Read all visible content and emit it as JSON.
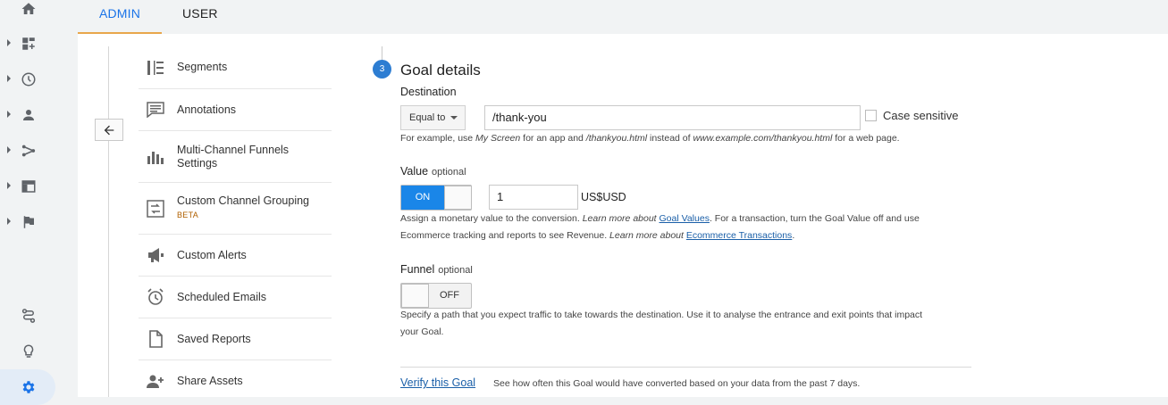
{
  "rail": {
    "items": [
      {
        "icon": "home-icon"
      },
      {
        "icon": "dashboard-add-icon"
      },
      {
        "icon": "clock-icon"
      },
      {
        "icon": "person-icon"
      },
      {
        "icon": "acquisition-icon"
      },
      {
        "icon": "behavior-icon"
      },
      {
        "icon": "flag-icon"
      },
      {
        "icon": "route-icon"
      },
      {
        "icon": "lightbulb-icon"
      },
      {
        "icon": "gear-icon"
      }
    ]
  },
  "tabs": {
    "admin": "ADMIN",
    "user": "USER"
  },
  "menu": {
    "items": [
      {
        "label": "Segments",
        "icon": "segments-icon"
      },
      {
        "label": "Annotations",
        "icon": "annotations-icon"
      },
      {
        "label": "Multi-Channel Funnels Settings",
        "icon": "bar-chart-icon"
      },
      {
        "label": "Custom Channel Grouping",
        "badge": "BETA",
        "icon": "channel-grouping-icon"
      },
      {
        "label": "Custom Alerts",
        "icon": "megaphone-icon"
      },
      {
        "label": "Scheduled Emails",
        "icon": "alarm-clock-icon"
      },
      {
        "label": "Saved Reports",
        "icon": "document-icon"
      },
      {
        "label": "Share Assets",
        "icon": "add-person-icon"
      }
    ]
  },
  "goal": {
    "step": "3",
    "title": "Goal details",
    "destination": {
      "label": "Destination",
      "match_type": "Equal to",
      "value": "/thank-you",
      "case_sensitive_label": "Case sensitive",
      "case_sensitive": false,
      "help_1": "For example, use ",
      "help_example_app": "My Screen",
      "help_2": " for an app and ",
      "help_example_path": "/thankyou.html",
      "help_3": " instead of ",
      "help_example_url": "www.example.com/thankyou.html",
      "help_4": " for a web page."
    },
    "value": {
      "label": "Value",
      "optional": "optional",
      "toggle_text": "ON",
      "amount": "1",
      "currency": "US$USD",
      "help_1": "Assign a monetary value to the conversion. ",
      "learn_more_1": "Learn more about ",
      "link_goal_values": "Goal Values",
      "help_2": ". For a transaction, turn the Goal Value off and use",
      "help_3": "Ecommerce tracking and reports to see Revenue. ",
      "learn_more_2": "Learn more about ",
      "link_ecommerce": "Ecommerce Transactions",
      "help_end": "."
    },
    "funnel": {
      "label": "Funnel",
      "optional": "optional",
      "toggle_text": "OFF",
      "help_1": "Specify a path that you expect traffic to take towards the destination. Use it to analyse the entrance and exit points that impact",
      "help_2": "your Goal."
    },
    "verify": {
      "link": "Verify this Goal",
      "description": "See how often this Goal would have converted based on your data from the past 7 days."
    }
  },
  "colors": {
    "accent": "#1a73e8",
    "toggle_on": "#1a86e8",
    "step": "#2d7dd2",
    "tab_underline": "#e8a64b"
  }
}
